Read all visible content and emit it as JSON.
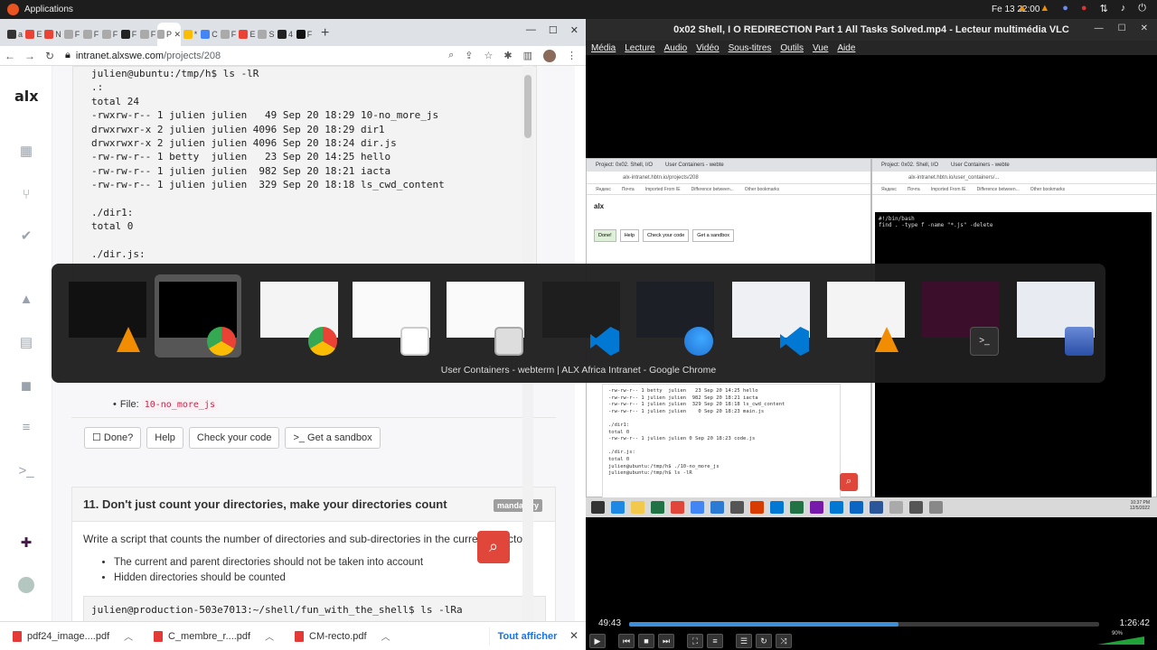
{
  "topbar": {
    "applications": "Applications",
    "clock": "Fe 13  22:00"
  },
  "chrome": {
    "tabs": [
      "a",
      "E",
      "N",
      "F",
      "F",
      "F",
      "F",
      "F",
      "P",
      "*",
      "C",
      "F",
      "E",
      "S",
      "4",
      "F"
    ],
    "url_host": "intranet.alxswe.com",
    "url_path": "/projects/208",
    "sidebar_logo": "alx",
    "code_output": "julien@ubuntu:/tmp/h$ ls -lR\n.:\ntotal 24\n-rwxrw-r-- 1 julien julien   49 Sep 20 18:29 10-no_more_js\ndrwxrwxr-x 2 julien julien 4096 Sep 20 18:29 dir1\ndrwxrwxr-x 2 julien julien 4096 Sep 20 18:24 dir.js\n-rw-rw-r-- 1 betty  julien   23 Sep 20 14:25 hello\n-rw-rw-r-- 1 julien julien  982 Sep 20 18:21 iacta\n-rw-rw-r-- 1 julien julien  329 Sep 20 18:18 ls_cwd_content\n\n./dir1:\ntotal 0\n\n./dir.js:",
    "file_label": "File:",
    "file_name": "10-no_more_js",
    "buttons": {
      "done": "Done?",
      "help": "Help",
      "check": "Check your code",
      "sandbox": "Get a sandbox"
    },
    "task11": {
      "title": "11. Don't just count your directories, make your directories count",
      "badge": "mandatory",
      "description": "Write a script that counts the number of directories and sub-directories in the current directory.",
      "bullets": [
        "The current and parent directories should not be taken into account",
        "Hidden directories should be counted"
      ],
      "command": "julien@production-503e7013:~/shell/fun_with_the_shell$ ls -lRa"
    },
    "downloads": [
      {
        "name": "pdf24_image....pdf"
      },
      {
        "name": "C_membre_r....pdf"
      },
      {
        "name": "CM-recto.pdf"
      }
    ],
    "show_all": "Tout afficher"
  },
  "vlc": {
    "title": "0x02 Shell, I O REDIRECTION Part 1 All Tasks Solved.mp4 - Lecteur multimédia VLC",
    "menu": [
      "Média",
      "Lecture",
      "Audio",
      "Vidéo",
      "Sous-titres",
      "Outils",
      "Vue",
      "Aide"
    ],
    "elapsed": "49:43",
    "duration": "1:26:42",
    "progress_fraction": 0.573,
    "volume_label": "90%",
    "video": {
      "left_tabs": [
        "Project: 0x02. Shell, I/O",
        "User Containers - webte"
      ],
      "right_tabs": [
        "Project: 0x02. Shell, I/O",
        "User Containers - webte"
      ],
      "left_url": "alx-intranet.hbtn.io/projects/208",
      "right_url": "alx-intranet.hbtn.io/user_containers/...",
      "bookmarks": [
        "Яндекс",
        "Почта",
        "Imported From IE",
        "Difference between...",
        "Other bookmarks"
      ],
      "left_buttons": [
        "Done!",
        "Help",
        "Check your code",
        "Get a sandbox"
      ],
      "right_terminal": "#!/bin/bash\nfind . -type f -name \"*.js\" -delete",
      "left_terminal": "-rw-rw-r-- 1 betty  julien   23 Sep 20 14:25 hello\n-rw-rw-r-- 1 julien julien  982 Sep 20 18:21 iacta\n-rw-rw-r-- 1 julien julien  329 Sep 20 18:18 ls_cwd_content\n-rw-rw-r-- 1 julien julien    0 Sep 20 18:23 main.js\n\n./dir1:\ntotal 0\n-rw-rw-r-- 1 julien julien 0 Sep 20 18:23 code.js\n\n./dir.js:\ntotal 0\njulien@ubuntu:/tmp/h$ ./10-no_more_js\njulien@ubuntu:/tmp/h$ ls -lR",
      "taskbar_clock": "10:37 PM\n12/5/2022"
    }
  },
  "switcher": {
    "selected_label": "User Containers - webterm | ALX Africa Intranet - Google Chrome",
    "windows": [
      {
        "app": "vlc-icon"
      },
      {
        "app": "chrome-icon"
      },
      {
        "app": "chrome-icon"
      },
      {
        "app": "text-editor-icon"
      },
      {
        "app": "files-icon"
      },
      {
        "app": "vscode-icon"
      },
      {
        "app": "firefox-icon"
      },
      {
        "app": "vscode-icon"
      },
      {
        "app": "vlc-icon"
      },
      {
        "app": "terminal-icon"
      },
      {
        "app": "settings-icon"
      }
    ]
  },
  "colors": {
    "alx_red": "#e0473a",
    "vlc_seek": "#3c8fd8",
    "ubuntu_orange": "#e95420"
  }
}
